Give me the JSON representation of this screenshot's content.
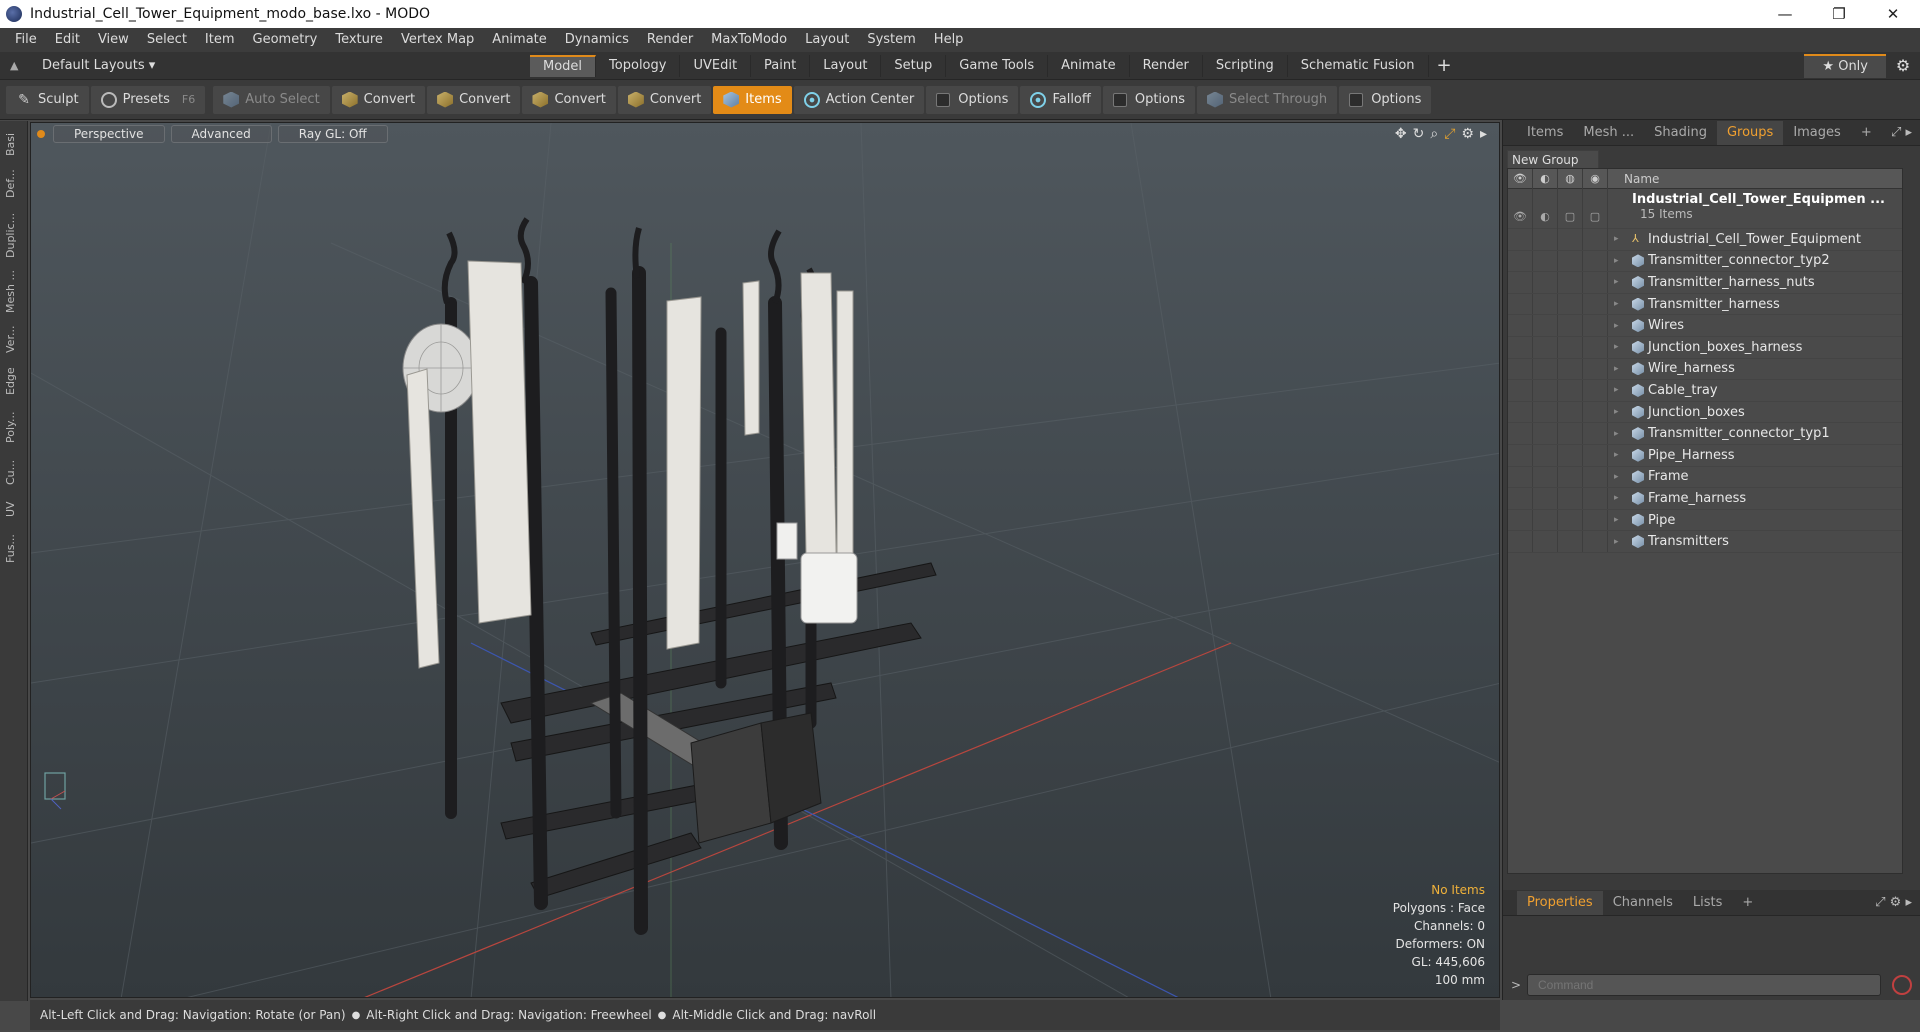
{
  "window": {
    "title": "Industrial_Cell_Tower_Equipment_modo_base.lxo - MODO",
    "minimize": "—",
    "restore": "❐",
    "close": "✕"
  },
  "menu": [
    "File",
    "Edit",
    "View",
    "Select",
    "Item",
    "Geometry",
    "Texture",
    "Vertex Map",
    "Animate",
    "Dynamics",
    "Render",
    "MaxToModo",
    "Layout",
    "System",
    "Help"
  ],
  "layout_bar": {
    "layouts_label": "Default Layouts ▾",
    "tabs": [
      "Model",
      "Topology",
      "UVEdit",
      "Paint",
      "Layout",
      "Setup",
      "Game Tools",
      "Animate",
      "Render",
      "Scripting",
      "Schematic Fusion"
    ],
    "active_tab": "Model",
    "add_icon": "+",
    "only_label": "★ Only",
    "gear_icon": "⚙"
  },
  "toolbar": {
    "sculpt": "Sculpt",
    "presets": "Presets",
    "presets_key": "F6",
    "auto_select": "Auto Select",
    "convert": "Convert",
    "items": "Items",
    "action_center": "Action Center",
    "options": "Options",
    "falloff": "Falloff",
    "select_through": "Select Through"
  },
  "left_tabs": [
    "Basi",
    "Def...",
    "Duplic...",
    "Mesh ...",
    "Ver...",
    "Edge",
    "Poly...",
    "Cu...",
    "UV",
    "Fus..."
  ],
  "viewport": {
    "perspective": "Perspective",
    "advanced": "Advanced",
    "raygl": "Ray GL: Off",
    "info": {
      "no_items": "No Items",
      "polygons": "Polygons : Face",
      "channels": "Channels: 0",
      "deformers": "Deformers: ON",
      "gl": "GL: 445,606",
      "scale": "100 mm"
    }
  },
  "right_panel": {
    "tabs": [
      "Items",
      "Mesh ...",
      "Shading",
      "Groups",
      "Images"
    ],
    "active_tab": "Groups",
    "tab_add": "+",
    "new_group": "New Group",
    "column_name": "Name",
    "group_name": "Industrial_Cell_Tower_Equipmen ...",
    "group_count": "15 Items",
    "items": [
      "Industrial_Cell_Tower_Equipment",
      "Transmitter_connector_typ2",
      "Transmitter_harness_nuts",
      "Transmitter_harness",
      "Wires",
      "Junction_boxes_harness",
      "Wire_harness",
      "Cable_tray",
      "Junction_boxes",
      "Transmitter_connector_typ1",
      "Pipe_Harness",
      "Frame",
      "Frame_harness",
      "Pipe",
      "Transmitters"
    ],
    "bottom_tabs": [
      "Properties",
      "Channels",
      "Lists"
    ],
    "bottom_active": "Properties",
    "command_placeholder": "Command"
  },
  "status_bar": {
    "hint1": "Alt-Left Click and Drag: Navigation: Rotate (or Pan)",
    "hint2": "Alt-Right Click and Drag: Navigation: Freewheel",
    "hint3": "Alt-Middle Click and Drag: navRoll"
  },
  "colors": {
    "accent": "#e38b17",
    "viewport_top": "#4f575d",
    "viewport_bottom": "#33393d"
  }
}
